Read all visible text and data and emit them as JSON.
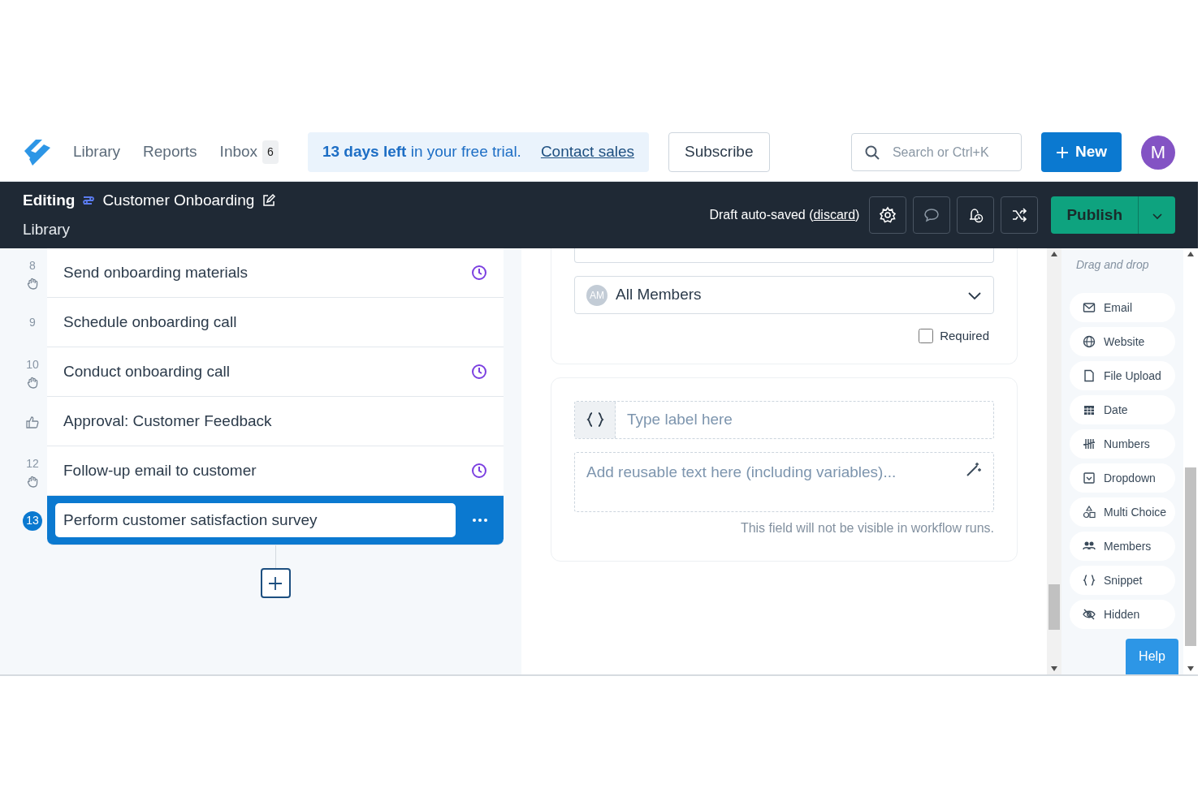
{
  "nav": {
    "links": [
      {
        "label": "Library"
      },
      {
        "label": "Reports"
      },
      {
        "label": "Inbox",
        "count": "6"
      }
    ],
    "trial": {
      "text": "**13 days left** in your free trial.",
      "link": "Contact sales"
    },
    "subscribe": "Subscribe",
    "search": {
      "placeholder": "Search or Ctrl+K"
    },
    "new_button": "New",
    "avatar": "M"
  },
  "editor": {
    "mode": "Editing",
    "title": "Customer Onboarding",
    "breadcrumb": "Library",
    "draft": {
      "status": "Draft auto-saved",
      "open": "(",
      "link": "discard",
      "close": ")"
    },
    "publish": "Publish"
  },
  "steps": [
    {
      "kind": "task",
      "number": "8",
      "label": "Send onboarding materials",
      "hand": true,
      "clock": true,
      "selected": false
    },
    {
      "kind": "task",
      "number": "9",
      "label": "Schedule onboarding call",
      "hand": false,
      "clock": false,
      "selected": false
    },
    {
      "kind": "task",
      "number": "10",
      "label": "Conduct onboarding call",
      "hand": true,
      "clock": true,
      "selected": false
    },
    {
      "kind": "approval",
      "label": "Approval: Customer Feedback",
      "hand": false,
      "clock": false,
      "selected": false
    },
    {
      "kind": "task",
      "number": "12",
      "label": "Follow-up email to customer",
      "hand": true,
      "clock": true,
      "selected": false
    },
    {
      "kind": "task",
      "number": "13",
      "label": "Perform customer satisfaction survey",
      "hand": false,
      "clock": false,
      "selected": true
    }
  ],
  "form": {
    "assignee": {
      "initials": "AM",
      "value": "All Members"
    },
    "required": {
      "label": "Required",
      "checked": false
    },
    "snippet": {
      "label_placeholder": "Type label here",
      "text_placeholder": "Add reusable text here (including variables)...",
      "note": "This field will not be visible in workflow runs."
    }
  },
  "palette": {
    "hint": "Drag and drop",
    "items": [
      {
        "kind": "email",
        "label": "Email"
      },
      {
        "kind": "website",
        "label": "Website"
      },
      {
        "kind": "file",
        "label": "File Upload"
      },
      {
        "kind": "date",
        "label": "Date"
      },
      {
        "kind": "numbers",
        "label": "Numbers"
      },
      {
        "kind": "dropdown",
        "label": "Dropdown"
      },
      {
        "kind": "choice",
        "label": "Multi Choice"
      },
      {
        "kind": "members",
        "label": "Members"
      },
      {
        "kind": "snippet",
        "label": "Snippet"
      },
      {
        "kind": "hidden",
        "label": "Hidden"
      }
    ]
  },
  "help": "Help"
}
